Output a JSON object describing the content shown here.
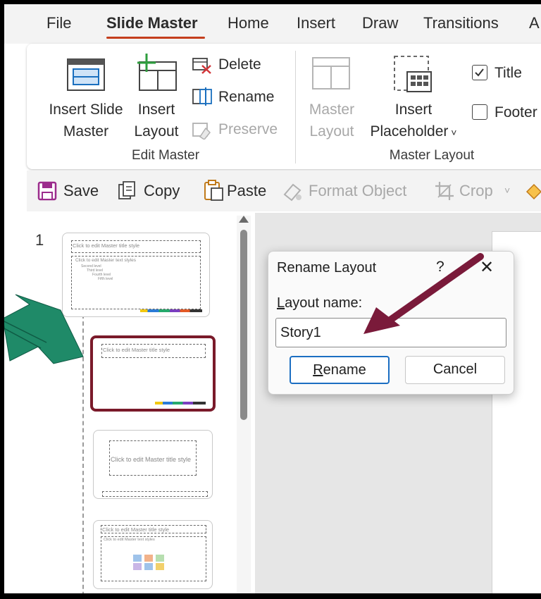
{
  "tabs": [
    "File",
    "Slide Master",
    "Home",
    "Insert",
    "Draw",
    "Transitions",
    "A"
  ],
  "ribbon": {
    "insert_slide_master": [
      "Insert Slide",
      "Master"
    ],
    "insert_layout": [
      "Insert",
      "Layout"
    ],
    "delete": "Delete",
    "rename": "Rename",
    "preserve": "Preserve",
    "edit_master_group": "Edit Master",
    "master_layout_btn": [
      "Master",
      "Layout"
    ],
    "insert_placeholder": [
      "Insert",
      "Placeholder"
    ],
    "title_checkbox": "Title",
    "footer_checkbox": "Footer",
    "master_layout_group": "Master Layout"
  },
  "toolbar": {
    "save": "Save",
    "copy": "Copy",
    "paste": "Paste",
    "format_object": "Format Object",
    "crop": "Crop"
  },
  "panel": {
    "slide_number": "1",
    "thumb_title_text": "Click to edit Master title style",
    "thumb_body_text": "Click to edit Master text styles",
    "thumb_levels": [
      "Second level",
      "Third level",
      "Fourth level",
      "Fifth level"
    ]
  },
  "dialog": {
    "title": "Rename Layout",
    "help": "?",
    "close": "✕",
    "label_prefix": "L",
    "label_rest": "ayout name:",
    "value": "Story1",
    "rename_prefix": "R",
    "rename_rest": "ename",
    "cancel": "Cancel"
  },
  "colors": {
    "accent_tab": "#c43e1c",
    "selected_thumb": "#7a1a2a",
    "annotation_green": "#1f8a68",
    "annotation_maroon": "#7a1a3a",
    "primary_button_border": "#1b6ec2"
  }
}
